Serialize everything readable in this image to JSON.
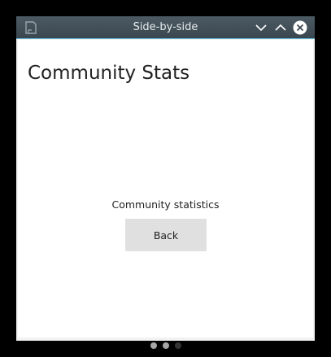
{
  "window": {
    "title": "Side-by-side",
    "icons": {
      "app": "app-document-icon",
      "minimize": "chevron-down-icon",
      "maximize": "chevron-up-icon",
      "close": "close-icon"
    },
    "colors": {
      "titlebar": "#3f4b53",
      "accent": "#5fb8d8"
    }
  },
  "page": {
    "title": "Community Stats",
    "description": "Community statistics",
    "back_label": "Back"
  },
  "pagination": {
    "count": 3,
    "active_index": 2
  }
}
